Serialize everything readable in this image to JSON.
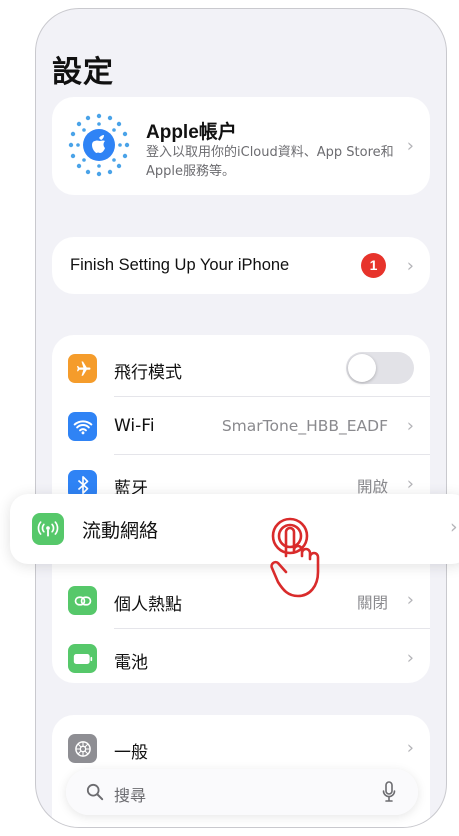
{
  "header": {
    "title": "設定"
  },
  "account": {
    "name": "Apple帳户",
    "description": "登入以取用你的iCloud資料、App Store和Apple服務等。"
  },
  "finish_setup": {
    "label": "Finish Setting Up Your iPhone",
    "badge": "1"
  },
  "settings": [
    {
      "id": "airplane",
      "label": "飛行模式",
      "icon": "airplane-icon",
      "color": "#f59c2b",
      "toggle": false
    },
    {
      "id": "wifi",
      "label": "Wi-Fi",
      "icon": "wifi-icon",
      "color": "#2f83f5",
      "value": "SmarTone_HBB_EADF"
    },
    {
      "id": "bluetooth",
      "label": "藍牙",
      "icon": "bluetooth-icon",
      "color": "#2f83f5",
      "value": "開啟"
    },
    {
      "id": "cellular",
      "label": "流動網絡",
      "icon": "cellular-antenna-icon",
      "color": "#56c86a",
      "highlighted": true
    },
    {
      "id": "hotspot",
      "label": "個人熱點",
      "icon": "link-icon",
      "color": "#56c86a",
      "value": "關閉"
    },
    {
      "id": "battery",
      "label": "電池",
      "icon": "battery-icon",
      "color": "#56c86a"
    }
  ],
  "general": {
    "label": "一般",
    "icon": "gear-icon",
    "color": "#8e8e93"
  },
  "search": {
    "placeholder": "搜尋"
  },
  "gesture": {
    "icon": "tap-hand-icon",
    "color": "#d92b2b"
  }
}
